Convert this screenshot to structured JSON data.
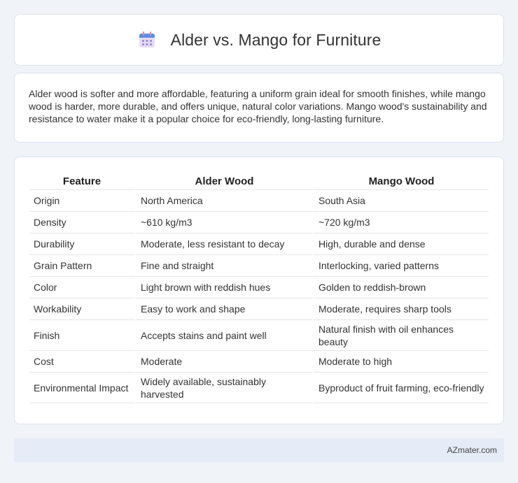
{
  "header": {
    "title": "Alder vs. Mango for Furniture",
    "icon": "calendar-icon"
  },
  "intro": {
    "text": "Alder wood is softer and more affordable, featuring a uniform grain ideal for smooth finishes, while mango wood is harder, more durable, and offers unique, natural color variations. Mango wood's sustainability and resistance to water make it a popular choice for eco-friendly, long-lasting furniture."
  },
  "table": {
    "headers": [
      "Feature",
      "Alder Wood",
      "Mango Wood"
    ],
    "rows": [
      [
        "Origin",
        "North America",
        "South Asia"
      ],
      [
        "Density",
        "~610 kg/m3",
        "~720 kg/m3"
      ],
      [
        "Durability",
        "Moderate, less resistant to decay",
        "High, durable and dense"
      ],
      [
        "Grain Pattern",
        "Fine and straight",
        "Interlocking, varied patterns"
      ],
      [
        "Color",
        "Light brown with reddish hues",
        "Golden to reddish-brown"
      ],
      [
        "Workability",
        "Easy to work and shape",
        "Moderate, requires sharp tools"
      ],
      [
        "Finish",
        "Accepts stains and paint well",
        "Natural finish with oil enhances beauty"
      ],
      [
        "Cost",
        "Moderate",
        "Moderate to high"
      ],
      [
        "Environmental Impact",
        "Widely available, sustainably harvested",
        "Byproduct of fruit farming, eco-friendly"
      ]
    ]
  },
  "footer": {
    "brand": "AZmater.com"
  }
}
